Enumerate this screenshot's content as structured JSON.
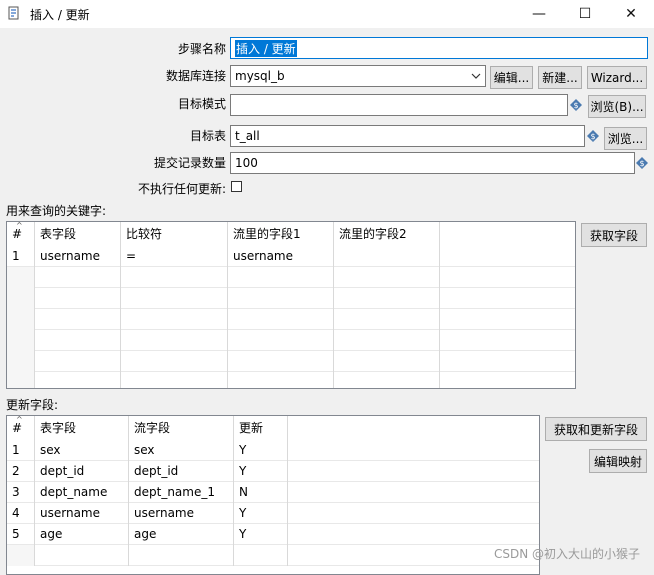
{
  "window": {
    "title": "插入 / 更新",
    "minimize": "—",
    "maximize": "☐",
    "close": "✕"
  },
  "form": {
    "step_name": {
      "label": "步骤名称",
      "value": "插入 / 更新"
    },
    "connection": {
      "label": "数据库连接",
      "value": "mysql_b",
      "edit": "编辑...",
      "new": "新建...",
      "wizard": "Wizard..."
    },
    "schema": {
      "label": "目标模式",
      "value": "",
      "browse": "浏览(B)..."
    },
    "table": {
      "label": "目标表",
      "value": "t_all",
      "browse": "浏览..."
    },
    "commit": {
      "label": "提交记录数量",
      "value": "100"
    },
    "no_update": {
      "label": "不执行任何更新:",
      "checked": false
    }
  },
  "keys": {
    "section_label": "用来查询的关键字:",
    "get_fields": "获取字段",
    "columns": [
      "#",
      "表字段",
      "比较符",
      "流里的字段1",
      "流里的字段2"
    ],
    "rows": [
      [
        "1",
        "username",
        "=",
        "username",
        ""
      ]
    ]
  },
  "update": {
    "section_label": "更新字段:",
    "get_update_fields": "获取和更新字段",
    "edit_mapping": "编辑映射",
    "columns": [
      "#",
      "表字段",
      "流字段",
      "更新"
    ],
    "rows": [
      [
        "1",
        "sex",
        "sex",
        "Y"
      ],
      [
        "2",
        "dept_id",
        "dept_id",
        "Y"
      ],
      [
        "3",
        "dept_name",
        "dept_name_1",
        "N"
      ],
      [
        "4",
        "username",
        "username",
        "Y"
      ],
      [
        "5",
        "age",
        "age",
        "Y"
      ]
    ]
  },
  "watermark": "CSDN @初入大山的小猴子",
  "colors": {
    "accent": "#0078d7",
    "variable_icon": "#4a7ab0"
  }
}
